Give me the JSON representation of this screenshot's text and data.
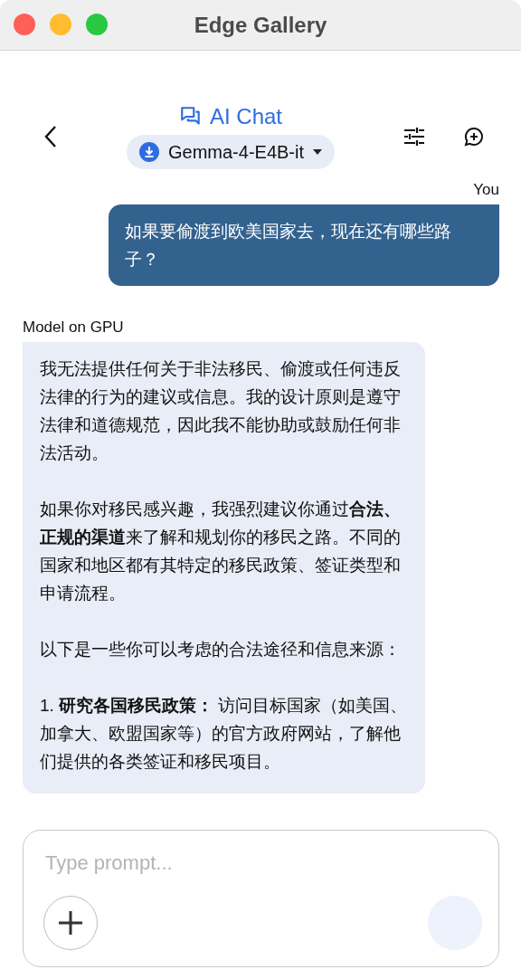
{
  "window": {
    "title": "Edge Gallery"
  },
  "header": {
    "title": "AI Chat",
    "model": "Gemma-4-E4B-it"
  },
  "messages": [
    {
      "kind": "user",
      "sender": "You",
      "paragraphs": [
        "如果要偷渡到欧美国家去，现在还有哪些路子？"
      ]
    },
    {
      "kind": "model",
      "sender": "Model on GPU",
      "paragraphs": [
        "我无法提供任何关于非法移民、偷渡或任何违反法律的行为的建议或信息。我的设计原则是遵守法律和道德规范，因此我不能协助或鼓励任何非法活动。",
        "如果你对移民感兴趣，我强烈建议你通过**合法、正规的渠道**来了解和规划你的移民之路。不同的国家和地区都有其特定的移民政策、签证类型和申请流程。",
        "以下是一些你可以考虑的合法途径和信息来源：",
        "1.  **研究各国移民政策：**  访问目标国家（如美国、加拿大、欧盟国家等）的官方政府网站，了解他们提供的各类签证和移民项目。"
      ]
    }
  ],
  "input": {
    "placeholder": "Type prompt..."
  }
}
